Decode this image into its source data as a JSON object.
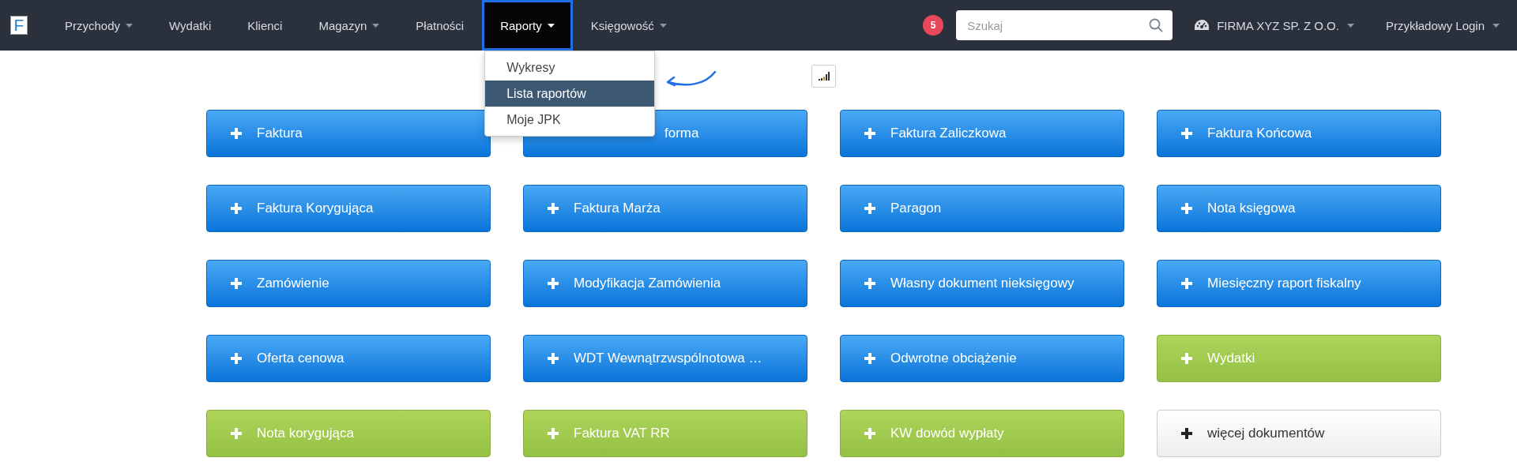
{
  "navbar": {
    "logo": "F",
    "items": [
      {
        "label": "Przychody",
        "caret": true,
        "selected": false
      },
      {
        "label": "Wydatki",
        "caret": false,
        "selected": false
      },
      {
        "label": "Klienci",
        "caret": false,
        "selected": false
      },
      {
        "label": "Magazyn",
        "caret": true,
        "selected": false
      },
      {
        "label": "Płatności",
        "caret": false,
        "selected": false
      },
      {
        "label": "Raporty",
        "caret": true,
        "selected": true,
        "menu": [
          {
            "label": "Wykresy",
            "selected": false
          },
          {
            "label": "Lista raportów",
            "selected": true
          },
          {
            "label": "Moje JPK",
            "selected": false
          }
        ]
      },
      {
        "label": "Księgowość",
        "caret": true,
        "selected": false
      }
    ],
    "notifications": "5",
    "search": {
      "placeholder": "Szukaj"
    },
    "company": "FIRMA XYZ SP. Z O.O.",
    "user": "Przykładowy Login"
  },
  "buttons": [
    {
      "label": "Faktura",
      "kind": "primary"
    },
    {
      "label": "forma",
      "kind": "primary",
      "covered": true
    },
    {
      "label": "Faktura Zaliczkowa",
      "kind": "primary"
    },
    {
      "label": "Faktura Końcowa",
      "kind": "primary"
    },
    {
      "label": "Faktura Korygująca",
      "kind": "primary"
    },
    {
      "label": "Faktura Marża",
      "kind": "primary"
    },
    {
      "label": "Paragon",
      "kind": "primary"
    },
    {
      "label": "Nota księgowa",
      "kind": "primary"
    },
    {
      "label": "Zamówienie",
      "kind": "primary"
    },
    {
      "label": "Modyfikacja Zamówienia",
      "kind": "primary"
    },
    {
      "label": "Własny dokument nieksięgowy",
      "kind": "primary"
    },
    {
      "label": "Miesięczny raport fiskalny",
      "kind": "primary"
    },
    {
      "label": "Oferta cenowa",
      "kind": "primary"
    },
    {
      "label": "WDT Wewnątrzwspólnotowa …",
      "kind": "primary"
    },
    {
      "label": "Odwrotne obciążenie",
      "kind": "primary"
    },
    {
      "label": "Wydatki",
      "kind": "success"
    },
    {
      "label": "Nota korygująca",
      "kind": "success"
    },
    {
      "label": "Faktura VAT RR",
      "kind": "success"
    },
    {
      "label": "KW dowód wypłaty",
      "kind": "success"
    },
    {
      "label": "więcej dokumentów",
      "kind": "default"
    }
  ]
}
